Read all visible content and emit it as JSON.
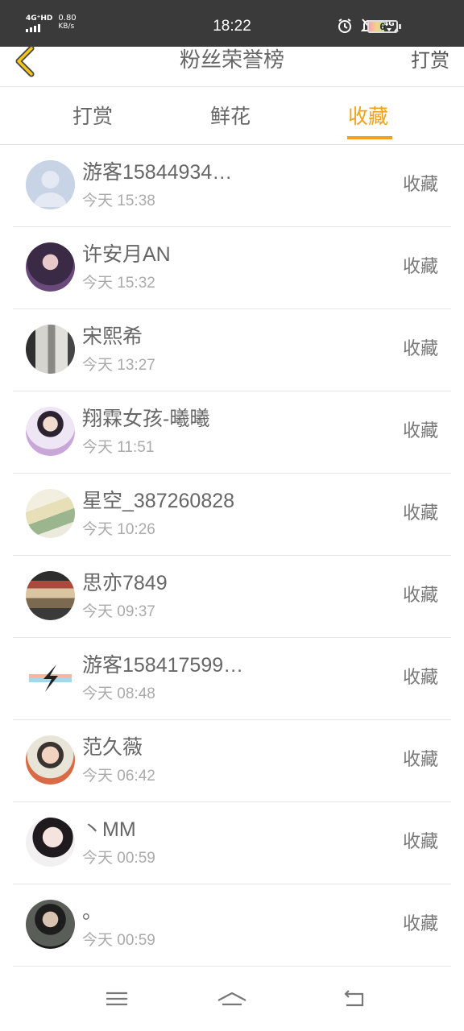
{
  "status_bar": {
    "network": "4G⁺HD",
    "speed_value": "0.80",
    "speed_unit": "KB/s",
    "time": "18:22",
    "battery": "6",
    "battery_level": 0.1
  },
  "header": {
    "title": "粉丝荣誉榜",
    "action": "打赏"
  },
  "tabs": [
    {
      "label": "打赏",
      "active": false
    },
    {
      "label": "鲜花",
      "active": false
    },
    {
      "label": "收藏",
      "active": true
    }
  ],
  "colors": {
    "accent": "#f0a21e",
    "status_bar_bg": "#3a3a3a"
  },
  "list": [
    {
      "name": "游客15844934…",
      "time": "今天 15:38",
      "action": "收藏",
      "avatar": "default-avatar"
    },
    {
      "name": "许安月AN",
      "time": "今天 15:32",
      "action": "收藏",
      "avatar": "user-photo"
    },
    {
      "name": "宋熙希",
      "time": "今天 13:27",
      "action": "收藏",
      "avatar": "user-photo"
    },
    {
      "name": "翔霖女孩-曦曦",
      "time": "今天 11:51",
      "action": "收藏",
      "avatar": "user-photo"
    },
    {
      "name": "星空_387260828",
      "time": "今天 10:26",
      "action": "收藏",
      "avatar": "user-photo"
    },
    {
      "name": "思亦7849",
      "time": "今天 09:37",
      "action": "收藏",
      "avatar": "user-photo"
    },
    {
      "name": "游客158417599…",
      "time": "今天 08:48",
      "action": "收藏",
      "avatar": "user-photo"
    },
    {
      "name": "范久薇",
      "time": "今天 06:42",
      "action": "收藏",
      "avatar": "user-photo"
    },
    {
      "name": "丶MM",
      "time": "今天 00:59",
      "action": "收藏",
      "avatar": "user-photo"
    },
    {
      "name": "。",
      "time": "今天 00:59",
      "action": "收藏",
      "avatar": "user-photo"
    }
  ],
  "navbar": {
    "menu_icon": "menu-icon",
    "home_icon": "home-icon",
    "back_icon": "back-icon"
  }
}
